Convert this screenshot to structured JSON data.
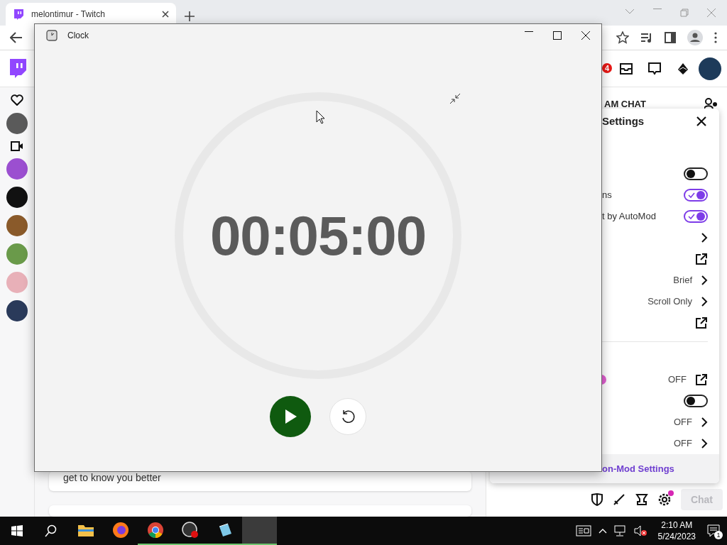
{
  "browser": {
    "tab_title": "melontimur - Twitch"
  },
  "twitch": {
    "notification_count": "4",
    "feed_text": "get to know you better"
  },
  "chat": {
    "header": "AM CHAT",
    "settings": {
      "title": "Settings",
      "footer": "on-Mod Settings",
      "rows": [
        {
          "kind": "toggle",
          "on": false
        },
        {
          "kind": "toggle",
          "label": "ns",
          "on": true
        },
        {
          "kind": "toggle",
          "label": "t by AutoMod",
          "on": true
        },
        {
          "kind": "chevron"
        },
        {
          "kind": "external"
        },
        {
          "kind": "chevron",
          "value": "Brief"
        },
        {
          "kind": "chevron",
          "value": "Scroll Only"
        },
        {
          "kind": "external"
        },
        {
          "kind": "divider"
        },
        {
          "kind": "external",
          "value": "OFF",
          "dot": true
        },
        {
          "kind": "toggle",
          "on": false
        },
        {
          "kind": "chevron",
          "value": "OFF"
        },
        {
          "kind": "chevron",
          "value": "OFF"
        }
      ]
    },
    "gear_alert": true,
    "chat_button": "Chat"
  },
  "clock": {
    "title": "Clock",
    "time": "00:05:00",
    "running": false
  },
  "taskbar": {
    "time": "2:10 AM",
    "date": "5/24/2023",
    "notifications": "1",
    "apps": [
      {
        "kind": "explorer",
        "open": false,
        "active": false
      },
      {
        "kind": "firefox",
        "open": false,
        "active": false
      },
      {
        "kind": "chrome",
        "open": true,
        "active": false
      },
      {
        "kind": "obs",
        "open": true,
        "active": false
      },
      {
        "kind": "notes",
        "open": true,
        "active": false
      },
      {
        "kind": "blank",
        "open": true,
        "active": true
      }
    ]
  }
}
